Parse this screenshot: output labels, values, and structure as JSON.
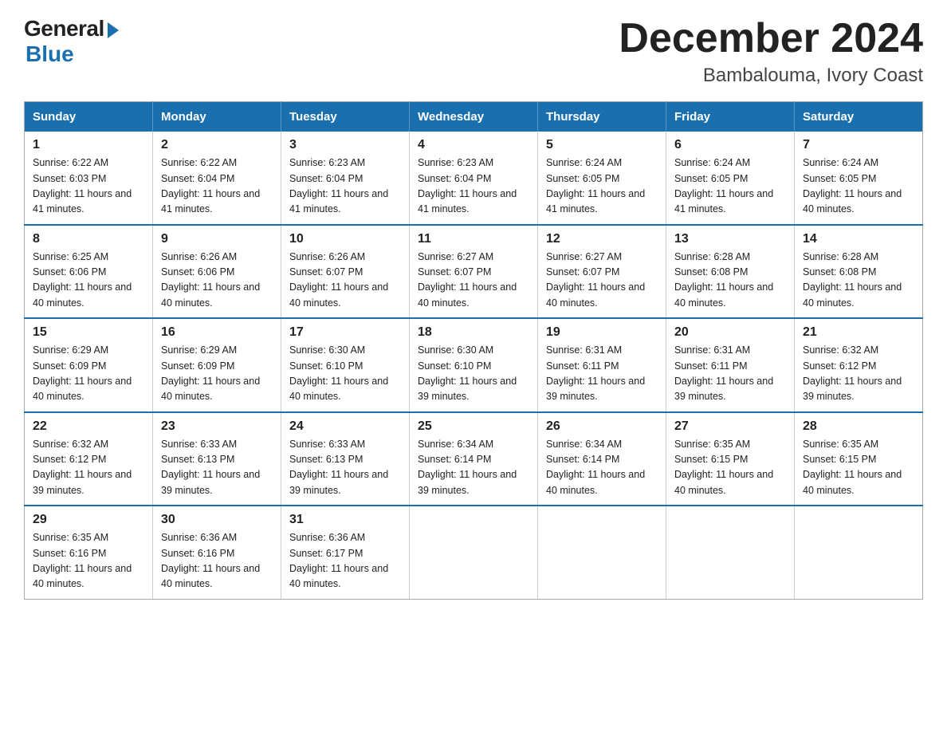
{
  "logo": {
    "general": "General",
    "blue": "Blue"
  },
  "title": {
    "month_year": "December 2024",
    "location": "Bambalouma, Ivory Coast"
  },
  "days_of_week": [
    "Sunday",
    "Monday",
    "Tuesday",
    "Wednesday",
    "Thursday",
    "Friday",
    "Saturday"
  ],
  "weeks": [
    [
      {
        "day": "1",
        "sunrise": "6:22 AM",
        "sunset": "6:03 PM",
        "daylight": "11 hours and 41 minutes."
      },
      {
        "day": "2",
        "sunrise": "6:22 AM",
        "sunset": "6:04 PM",
        "daylight": "11 hours and 41 minutes."
      },
      {
        "day": "3",
        "sunrise": "6:23 AM",
        "sunset": "6:04 PM",
        "daylight": "11 hours and 41 minutes."
      },
      {
        "day": "4",
        "sunrise": "6:23 AM",
        "sunset": "6:04 PM",
        "daylight": "11 hours and 41 minutes."
      },
      {
        "day": "5",
        "sunrise": "6:24 AM",
        "sunset": "6:05 PM",
        "daylight": "11 hours and 41 minutes."
      },
      {
        "day": "6",
        "sunrise": "6:24 AM",
        "sunset": "6:05 PM",
        "daylight": "11 hours and 41 minutes."
      },
      {
        "day": "7",
        "sunrise": "6:24 AM",
        "sunset": "6:05 PM",
        "daylight": "11 hours and 40 minutes."
      }
    ],
    [
      {
        "day": "8",
        "sunrise": "6:25 AM",
        "sunset": "6:06 PM",
        "daylight": "11 hours and 40 minutes."
      },
      {
        "day": "9",
        "sunrise": "6:26 AM",
        "sunset": "6:06 PM",
        "daylight": "11 hours and 40 minutes."
      },
      {
        "day": "10",
        "sunrise": "6:26 AM",
        "sunset": "6:07 PM",
        "daylight": "11 hours and 40 minutes."
      },
      {
        "day": "11",
        "sunrise": "6:27 AM",
        "sunset": "6:07 PM",
        "daylight": "11 hours and 40 minutes."
      },
      {
        "day": "12",
        "sunrise": "6:27 AM",
        "sunset": "6:07 PM",
        "daylight": "11 hours and 40 minutes."
      },
      {
        "day": "13",
        "sunrise": "6:28 AM",
        "sunset": "6:08 PM",
        "daylight": "11 hours and 40 minutes."
      },
      {
        "day": "14",
        "sunrise": "6:28 AM",
        "sunset": "6:08 PM",
        "daylight": "11 hours and 40 minutes."
      }
    ],
    [
      {
        "day": "15",
        "sunrise": "6:29 AM",
        "sunset": "6:09 PM",
        "daylight": "11 hours and 40 minutes."
      },
      {
        "day": "16",
        "sunrise": "6:29 AM",
        "sunset": "6:09 PM",
        "daylight": "11 hours and 40 minutes."
      },
      {
        "day": "17",
        "sunrise": "6:30 AM",
        "sunset": "6:10 PM",
        "daylight": "11 hours and 40 minutes."
      },
      {
        "day": "18",
        "sunrise": "6:30 AM",
        "sunset": "6:10 PM",
        "daylight": "11 hours and 39 minutes."
      },
      {
        "day": "19",
        "sunrise": "6:31 AM",
        "sunset": "6:11 PM",
        "daylight": "11 hours and 39 minutes."
      },
      {
        "day": "20",
        "sunrise": "6:31 AM",
        "sunset": "6:11 PM",
        "daylight": "11 hours and 39 minutes."
      },
      {
        "day": "21",
        "sunrise": "6:32 AM",
        "sunset": "6:12 PM",
        "daylight": "11 hours and 39 minutes."
      }
    ],
    [
      {
        "day": "22",
        "sunrise": "6:32 AM",
        "sunset": "6:12 PM",
        "daylight": "11 hours and 39 minutes."
      },
      {
        "day": "23",
        "sunrise": "6:33 AM",
        "sunset": "6:13 PM",
        "daylight": "11 hours and 39 minutes."
      },
      {
        "day": "24",
        "sunrise": "6:33 AM",
        "sunset": "6:13 PM",
        "daylight": "11 hours and 39 minutes."
      },
      {
        "day": "25",
        "sunrise": "6:34 AM",
        "sunset": "6:14 PM",
        "daylight": "11 hours and 39 minutes."
      },
      {
        "day": "26",
        "sunrise": "6:34 AM",
        "sunset": "6:14 PM",
        "daylight": "11 hours and 40 minutes."
      },
      {
        "day": "27",
        "sunrise": "6:35 AM",
        "sunset": "6:15 PM",
        "daylight": "11 hours and 40 minutes."
      },
      {
        "day": "28",
        "sunrise": "6:35 AM",
        "sunset": "6:15 PM",
        "daylight": "11 hours and 40 minutes."
      }
    ],
    [
      {
        "day": "29",
        "sunrise": "6:35 AM",
        "sunset": "6:16 PM",
        "daylight": "11 hours and 40 minutes."
      },
      {
        "day": "30",
        "sunrise": "6:36 AM",
        "sunset": "6:16 PM",
        "daylight": "11 hours and 40 minutes."
      },
      {
        "day": "31",
        "sunrise": "6:36 AM",
        "sunset": "6:17 PM",
        "daylight": "11 hours and 40 minutes."
      },
      null,
      null,
      null,
      null
    ]
  ]
}
